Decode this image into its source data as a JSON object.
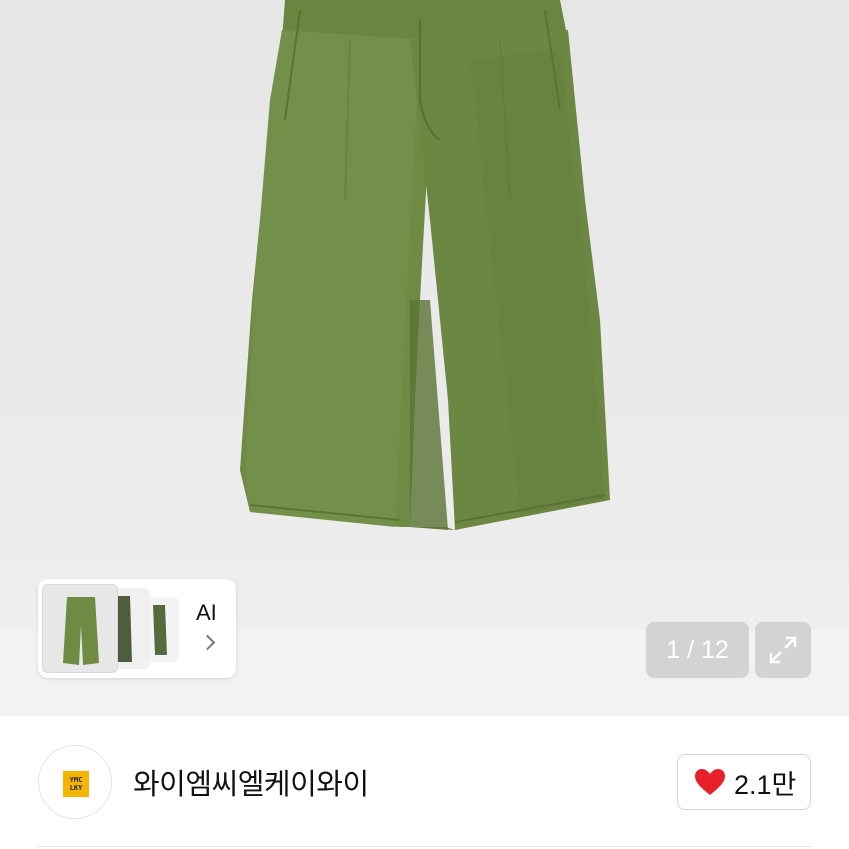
{
  "gallery": {
    "ai_label": "AI",
    "counter": "1 / 12",
    "colors": {
      "pants": "#6f8a43",
      "pants_shadow": "#5a7335"
    }
  },
  "seller": {
    "name": "와이엠씨엘케이와이",
    "logo_text_line1": "YMC",
    "logo_text_line2": "LKY",
    "logo_color": "#f4b400"
  },
  "like": {
    "count": "2.1만",
    "heart_color": "#e8202a"
  }
}
